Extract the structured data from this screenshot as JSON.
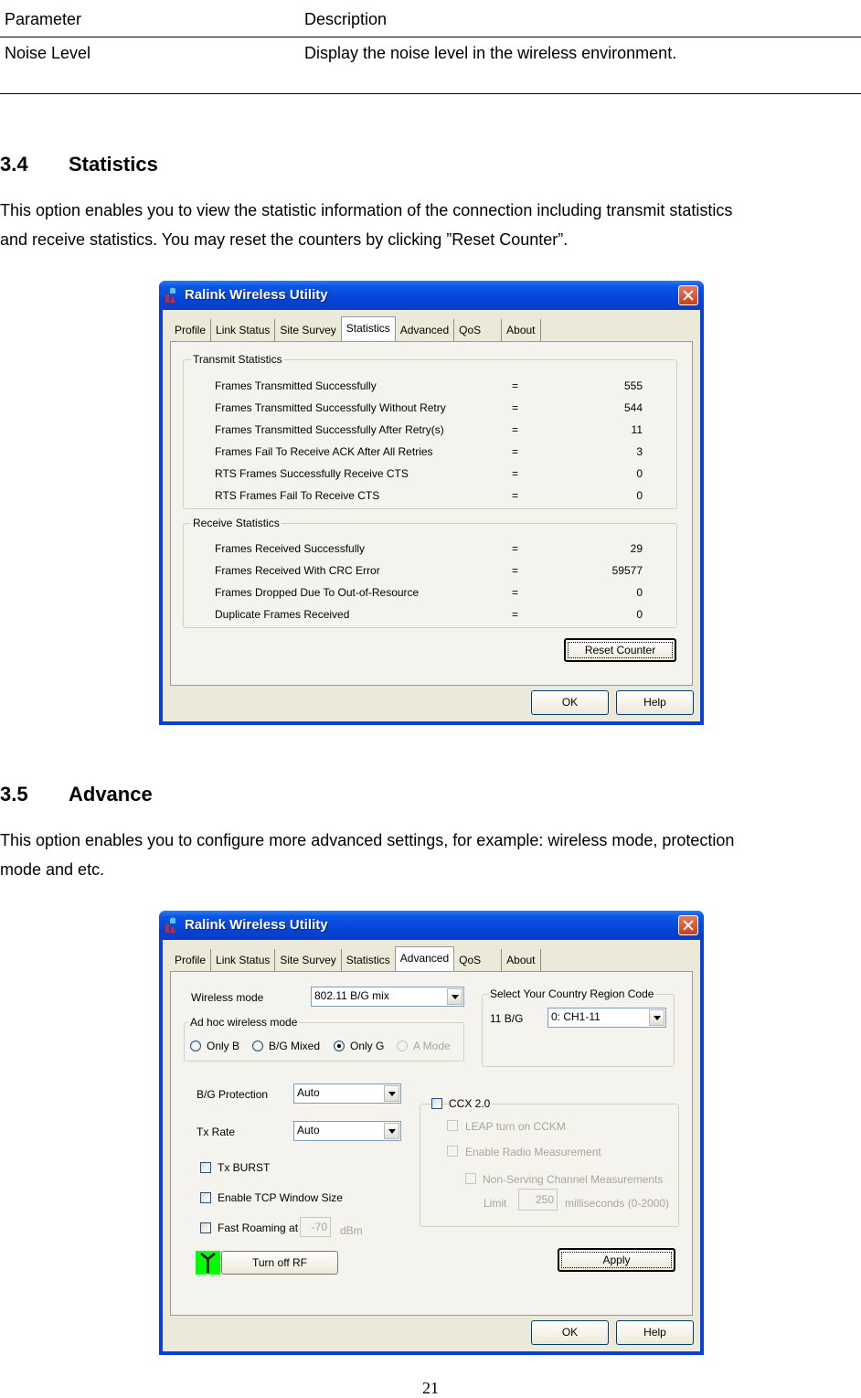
{
  "param_table": {
    "headers": [
      "Parameter",
      "Description"
    ],
    "rows": [
      [
        "Noise Level",
        "Display the noise level in the wireless environment."
      ]
    ]
  },
  "section_statistics": {
    "number": "3.4",
    "title": "Statistics",
    "paragraph_lines": [
      "This option enables you to view the statistic information of the connection including transmit statistics",
      "and receive statistics. You may reset the counters by clicking ”Reset Counter”."
    ]
  },
  "section_advance": {
    "number": "3.5",
    "title": "Advance",
    "paragraph_lines": [
      "This option enables you to configure more advanced settings, for example: wireless mode, protection",
      "mode and etc."
    ]
  },
  "window": {
    "title": "Ralink Wireless Utility",
    "tabs": [
      "Profile",
      "Link Status",
      "Site Survey",
      "Statistics",
      "Advanced",
      "QoS",
      "About"
    ],
    "ok_label": "OK",
    "help_label": "Help"
  },
  "statistics_window": {
    "active_tab": "Statistics",
    "transmit": {
      "label": "Transmit Statistics",
      "rows": [
        {
          "name": "Frames Transmitted Successfully",
          "eq": "=",
          "value": "555"
        },
        {
          "name": "Frames Transmitted Successfully  Without Retry",
          "eq": "=",
          "value": "544"
        },
        {
          "name": "Frames Transmitted Successfully After Retry(s)",
          "eq": "=",
          "value": "11"
        },
        {
          "name": "Frames Fail To Receive ACK After All Retries",
          "eq": "=",
          "value": "3"
        },
        {
          "name": "RTS Frames Successfully Receive CTS",
          "eq": "=",
          "value": "0"
        },
        {
          "name": "RTS Frames Fail To Receive CTS",
          "eq": "=",
          "value": "0"
        }
      ]
    },
    "receive": {
      "label": "Receive Statistics",
      "rows": [
        {
          "name": "Frames Received Successfully",
          "eq": "=",
          "value": "29"
        },
        {
          "name": "Frames Received With CRC Error",
          "eq": "=",
          "value": "59577"
        },
        {
          "name": "Frames Dropped Due To Out-of-Resource",
          "eq": "=",
          "value": "0"
        },
        {
          "name": "Duplicate Frames Received",
          "eq": "=",
          "value": "0"
        }
      ]
    },
    "reset_counter_label": "Reset Counter"
  },
  "advanced_window": {
    "active_tab": "Advanced",
    "wireless_mode_label": "Wireless mode",
    "wireless_mode_value": "802.11 B/G mix",
    "adhoc_group_label": "Ad hoc wireless mode",
    "adhoc_options": [
      {
        "label": "Only B",
        "selected": false,
        "disabled": false
      },
      {
        "label": "B/G Mixed",
        "selected": false,
        "disabled": false
      },
      {
        "label": "Only G",
        "selected": true,
        "disabled": false
      },
      {
        "label": "A Mode",
        "selected": false,
        "disabled": true
      }
    ],
    "country_group_label": "Select Your Country Region Code",
    "country_band_label": "11 B/G",
    "country_value": "0: CH1-11",
    "bg_protection_label": "B/G Protection",
    "bg_protection_value": "Auto",
    "tx_rate_label": "Tx Rate",
    "tx_rate_value": "Auto",
    "tx_burst_label": "Tx BURST",
    "tcp_window_label": "Enable TCP Window Size",
    "fast_roaming_label": "Fast Roaming at",
    "fast_roaming_value": "-70",
    "fast_roaming_unit": "dBm",
    "turn_off_rf_label": "Turn off RF",
    "rf_indicator_color": "#00ff00",
    "ccx_label": "CCX 2.0",
    "leap_label": "LEAP turn on CCKM",
    "radio_meas_label": "Enable Radio Measurement",
    "non_serving_label": "Non-Serving Channel Measurements",
    "limit_label": "Limit",
    "limit_value": "250",
    "limit_unit": "milliseconds (0-2000)",
    "apply_label": "Apply"
  },
  "page_number": "21"
}
